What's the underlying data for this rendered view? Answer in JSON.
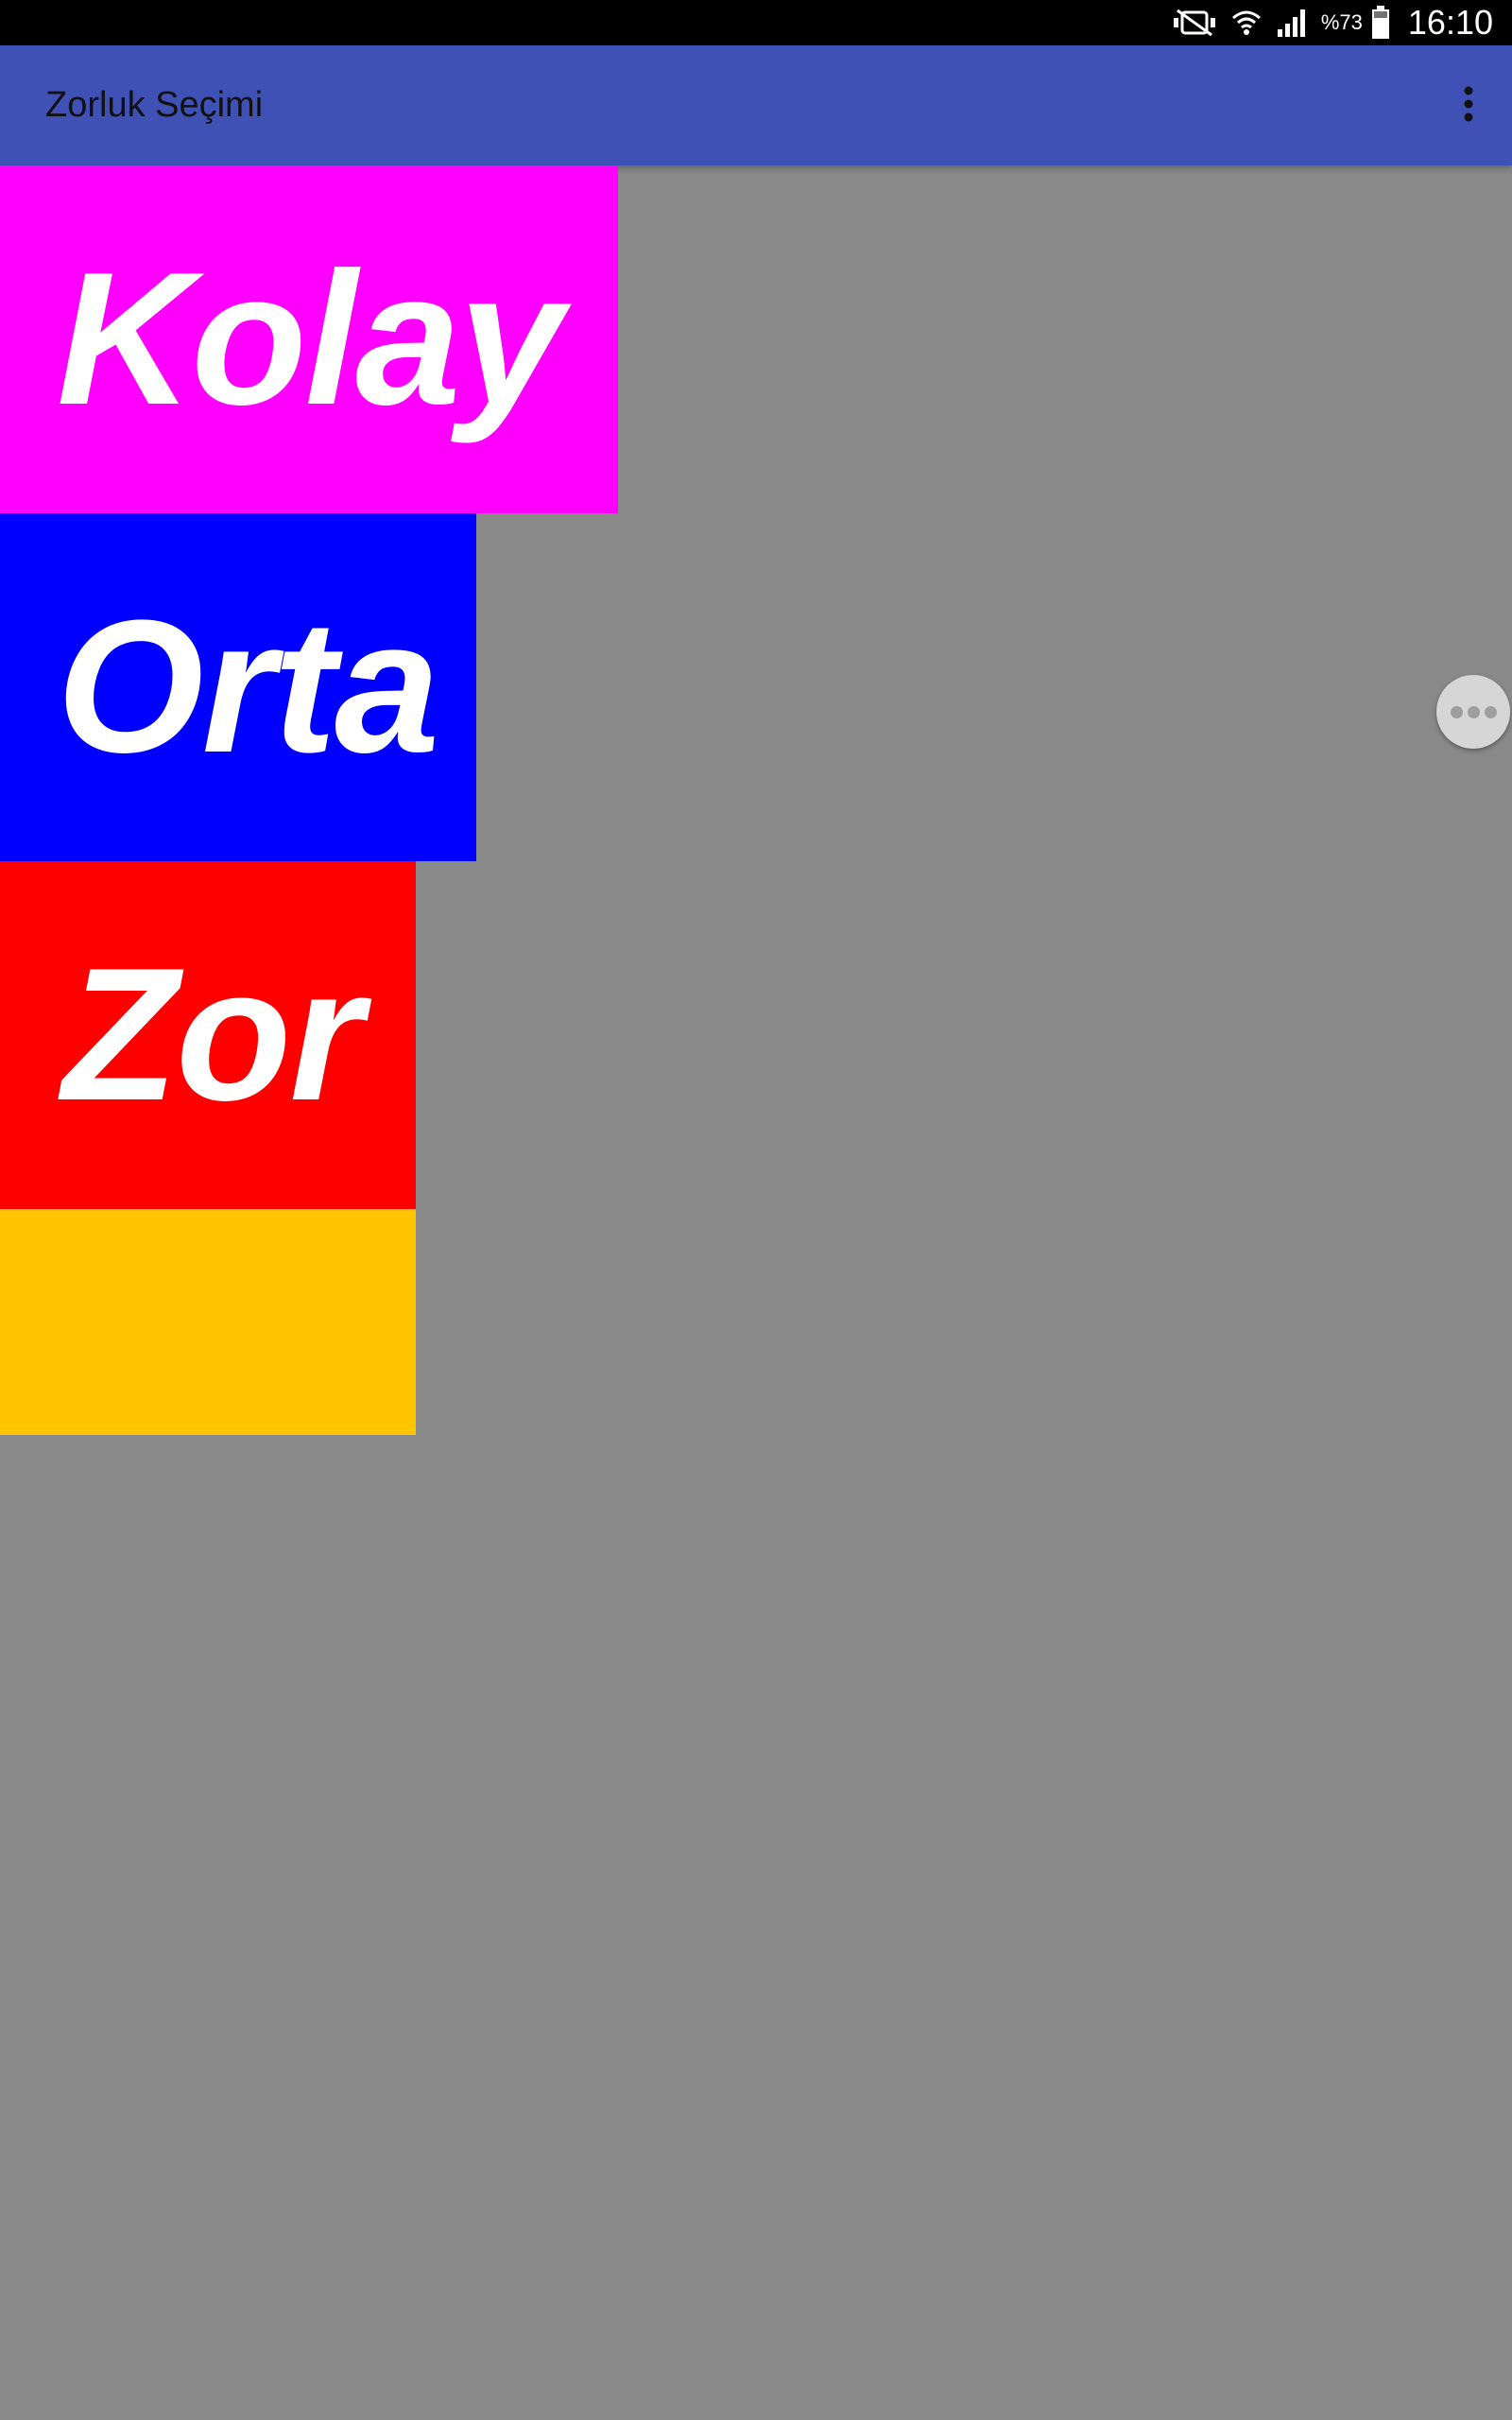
{
  "status_bar": {
    "battery_percent": "%73",
    "time": "16:10",
    "icons": [
      "mute-vibrate-icon",
      "wifi-icon",
      "cell-signal-icon",
      "battery-icon"
    ]
  },
  "app_bar": {
    "title": "Zorluk Seçimi",
    "overflow_icon": "more-vert-icon"
  },
  "difficulty_options": [
    {
      "label": "Kolay",
      "color": "#ff00ff"
    },
    {
      "label": "Orta",
      "color": "#0000ff"
    },
    {
      "label": "Zor",
      "color": "#ff0000"
    },
    {
      "label": "",
      "color": "#ffc600"
    }
  ],
  "colors": {
    "app_bar": "#3f51b5",
    "background": "#898989",
    "status_bar": "#000000"
  },
  "floating_handle_icon": "more-horiz-icon"
}
